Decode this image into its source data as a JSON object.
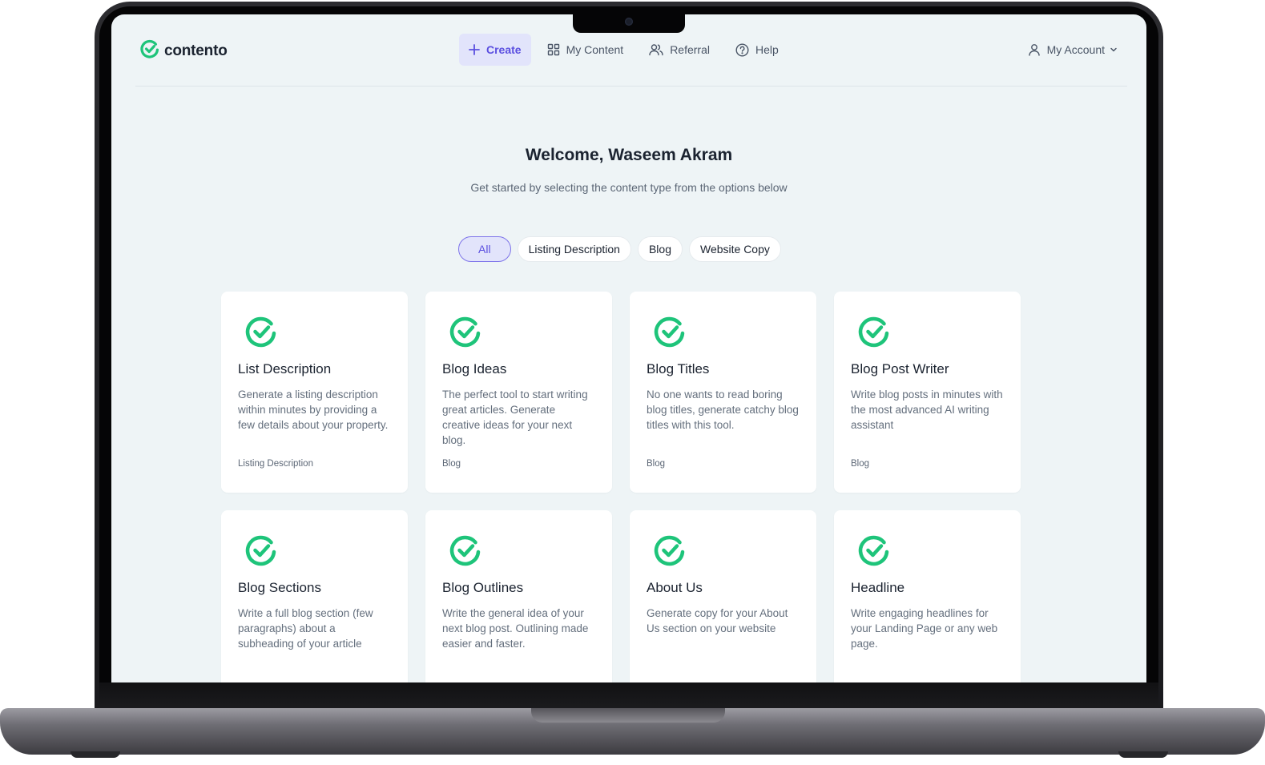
{
  "brand": {
    "name": "contento",
    "accent": "#1ec47a"
  },
  "nav": {
    "items": [
      {
        "label": "Create",
        "icon": "plus-icon",
        "active": true
      },
      {
        "label": "My Content",
        "icon": "grid-icon",
        "active": false
      },
      {
        "label": "Referral",
        "icon": "users-icon",
        "active": false
      },
      {
        "label": "Help",
        "icon": "help-circle-icon",
        "active": false
      }
    ],
    "account": {
      "label": "My Account",
      "icon": "user-icon"
    }
  },
  "hero": {
    "title": "Welcome, Waseem Akram",
    "subtitle": "Get started by selecting the content type from the options below"
  },
  "filters": [
    {
      "label": "All",
      "active": true
    },
    {
      "label": "Listing Description",
      "active": false
    },
    {
      "label": "Blog",
      "active": false
    },
    {
      "label": "Website Copy",
      "active": false
    }
  ],
  "cards": [
    {
      "title": "List Description",
      "description": "Generate a listing description within minutes by providing a few details about your property.",
      "tag": "Listing Description"
    },
    {
      "title": "Blog Ideas",
      "description": "The perfect tool to start writing great articles. Generate creative ideas for your next blog.",
      "tag": "Blog"
    },
    {
      "title": "Blog Titles",
      "description": "No one wants to read boring blog titles, generate catchy blog titles with this tool.",
      "tag": "Blog"
    },
    {
      "title": "Blog Post Writer",
      "description": "Write blog posts in minutes with the most advanced AI writing assistant",
      "tag": "Blog"
    },
    {
      "title": "Blog Sections",
      "description": "Write a full blog section (few paragraphs) about a subheading of your article",
      "tag": ""
    },
    {
      "title": "Blog Outlines",
      "description": "Write the general idea of your next blog post. Outlining made easier and faster.",
      "tag": ""
    },
    {
      "title": "About Us",
      "description": "Generate copy for your About Us section on your website",
      "tag": ""
    },
    {
      "title": "Headline",
      "description": "Write engaging headlines for your Landing Page or any web page.",
      "tag": ""
    }
  ]
}
